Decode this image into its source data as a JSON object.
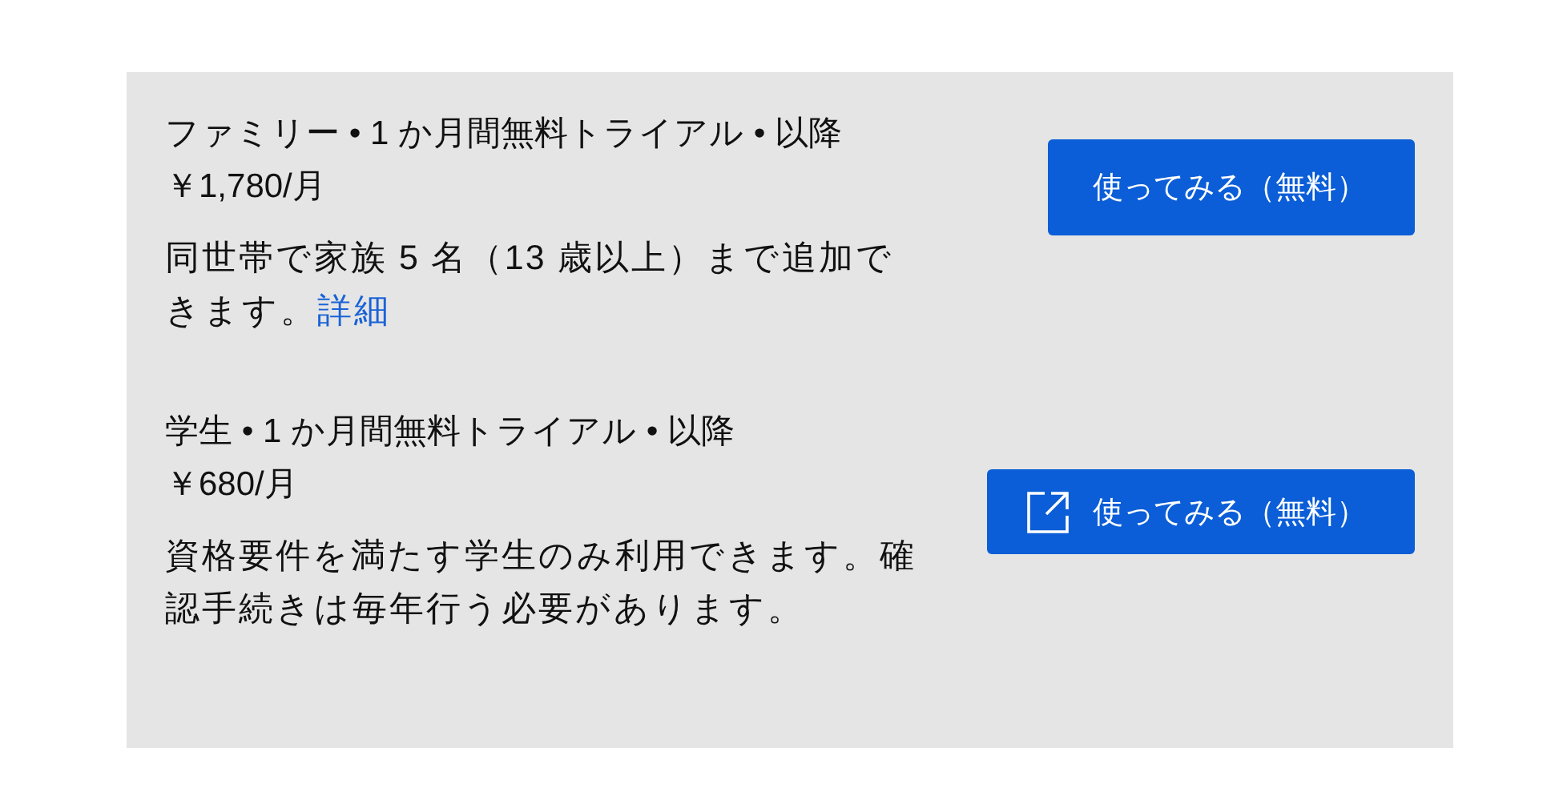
{
  "plans": [
    {
      "title": "ファミリー • 1 か月間無料トライアル • 以降",
      "price": "￥1,780/月",
      "description": "同世帯で家族 5 名（13 歳以上）まで追加できます。",
      "link": "詳細",
      "button": {
        "label": "使ってみる（無料）",
        "external_icon": false
      }
    },
    {
      "title": "学生 • 1 か月間無料トライアル • 以降",
      "price": "￥680/月",
      "description": "資格要件を満たす学生のみ利用できます。確認手続きは毎年行う必要があります。",
      "button": {
        "label": "使ってみる（無料）",
        "external_icon": true
      }
    }
  ]
}
